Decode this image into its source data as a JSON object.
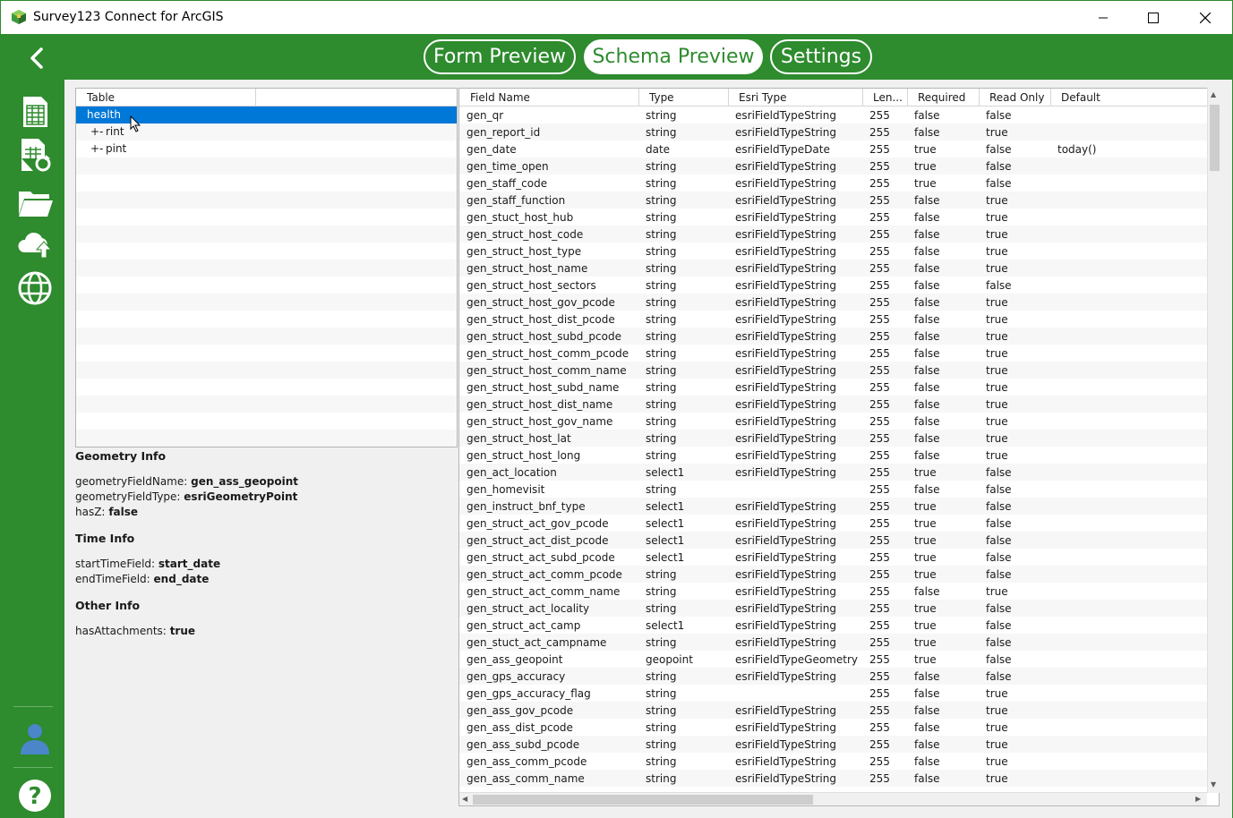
{
  "window": {
    "title": "Survey123 Connect for ArcGIS"
  },
  "tabs": [
    {
      "label": "Form Preview",
      "active": false
    },
    {
      "label": "Schema Preview",
      "active": true
    },
    {
      "label": "Settings",
      "active": false
    }
  ],
  "sidebar": {
    "items": [
      {
        "icon": "spreadsheet-icon"
      },
      {
        "icon": "spreadsheet-refresh-icon"
      },
      {
        "icon": "folder-icon"
      },
      {
        "icon": "cloud-upload-icon"
      },
      {
        "icon": "globe-icon"
      }
    ],
    "bottom": [
      {
        "icon": "user-icon"
      },
      {
        "icon": "help-icon"
      }
    ]
  },
  "tree": {
    "header": "Table",
    "rows": [
      {
        "label": "health",
        "indent": 0,
        "selected": true,
        "expander": ""
      },
      {
        "label": "rint",
        "indent": 1,
        "selected": false,
        "expander": "+-"
      },
      {
        "label": "pint",
        "indent": 1,
        "selected": false,
        "expander": "+-"
      }
    ]
  },
  "geometry_info": {
    "title": "Geometry Info",
    "rows": [
      {
        "key": "geometryFieldName:",
        "value": "gen_ass_geopoint"
      },
      {
        "key": "geometryFieldType:",
        "value": "esriGeometryPoint"
      },
      {
        "key": "hasZ:",
        "value": "false"
      }
    ]
  },
  "time_info": {
    "title": "Time Info",
    "rows": [
      {
        "key": "startTimeField:",
        "value": "start_date"
      },
      {
        "key": "endTimeField:",
        "value": "end_date"
      }
    ]
  },
  "other_info": {
    "title": "Other Info",
    "rows": [
      {
        "key": "hasAttachments:",
        "value": "true"
      }
    ]
  },
  "grid": {
    "headers": [
      "Field Name",
      "Type",
      "Esri Type",
      "Len...",
      "Required",
      "Read Only",
      "Default"
    ],
    "rows": [
      [
        "gen_qr",
        "string",
        "esriFieldTypeString",
        "255",
        "false",
        "false",
        ""
      ],
      [
        "gen_report_id",
        "string",
        "esriFieldTypeString",
        "255",
        "false",
        "true",
        ""
      ],
      [
        "gen_date",
        "date",
        "esriFieldTypeDate",
        "255",
        "true",
        "false",
        "today()"
      ],
      [
        "gen_time_open",
        "string",
        "esriFieldTypeString",
        "255",
        "true",
        "false",
        ""
      ],
      [
        "gen_staff_code",
        "string",
        "esriFieldTypeString",
        "255",
        "true",
        "false",
        ""
      ],
      [
        "gen_staff_function",
        "string",
        "esriFieldTypeString",
        "255",
        "false",
        "true",
        ""
      ],
      [
        "gen_stuct_host_hub",
        "string",
        "esriFieldTypeString",
        "255",
        "false",
        "true",
        ""
      ],
      [
        "gen_struct_host_code",
        "string",
        "esriFieldTypeString",
        "255",
        "false",
        "true",
        ""
      ],
      [
        "gen_struct_host_type",
        "string",
        "esriFieldTypeString",
        "255",
        "false",
        "true",
        ""
      ],
      [
        "gen_struct_host_name",
        "string",
        "esriFieldTypeString",
        "255",
        "false",
        "true",
        ""
      ],
      [
        "gen_struct_host_sectors",
        "string",
        "esriFieldTypeString",
        "255",
        "false",
        "false",
        ""
      ],
      [
        "gen_struct_host_gov_pcode",
        "string",
        "esriFieldTypeString",
        "255",
        "false",
        "true",
        ""
      ],
      [
        "gen_struct_host_dist_pcode",
        "string",
        "esriFieldTypeString",
        "255",
        "false",
        "true",
        ""
      ],
      [
        "gen_struct_host_subd_pcode",
        "string",
        "esriFieldTypeString",
        "255",
        "false",
        "true",
        ""
      ],
      [
        "gen_struct_host_comm_pcode",
        "string",
        "esriFieldTypeString",
        "255",
        "false",
        "true",
        ""
      ],
      [
        "gen_struct_host_comm_name",
        "string",
        "esriFieldTypeString",
        "255",
        "false",
        "true",
        ""
      ],
      [
        "gen_struct_host_subd_name",
        "string",
        "esriFieldTypeString",
        "255",
        "false",
        "true",
        ""
      ],
      [
        "gen_struct_host_dist_name",
        "string",
        "esriFieldTypeString",
        "255",
        "false",
        "true",
        ""
      ],
      [
        "gen_struct_host_gov_name",
        "string",
        "esriFieldTypeString",
        "255",
        "false",
        "true",
        ""
      ],
      [
        "gen_struct_host_lat",
        "string",
        "esriFieldTypeString",
        "255",
        "false",
        "true",
        ""
      ],
      [
        "gen_struct_host_long",
        "string",
        "esriFieldTypeString",
        "255",
        "false",
        "true",
        ""
      ],
      [
        "gen_act_location",
        "select1",
        "esriFieldTypeString",
        "255",
        "true",
        "false",
        ""
      ],
      [
        "gen_homevisit",
        "string",
        "",
        "255",
        "false",
        "false",
        ""
      ],
      [
        "gen_instruct_bnf_type",
        "select1",
        "esriFieldTypeString",
        "255",
        "true",
        "false",
        ""
      ],
      [
        "gen_struct_act_gov_pcode",
        "select1",
        "esriFieldTypeString",
        "255",
        "true",
        "false",
        ""
      ],
      [
        "gen_struct_act_dist_pcode",
        "select1",
        "esriFieldTypeString",
        "255",
        "true",
        "false",
        ""
      ],
      [
        "gen_struct_act_subd_pcode",
        "select1",
        "esriFieldTypeString",
        "255",
        "true",
        "false",
        ""
      ],
      [
        "gen_struct_act_comm_pcode",
        "string",
        "esriFieldTypeString",
        "255",
        "true",
        "false",
        ""
      ],
      [
        "gen_struct_act_comm_name",
        "string",
        "esriFieldTypeString",
        "255",
        "false",
        "true",
        ""
      ],
      [
        "gen_struct_act_locality",
        "string",
        "esriFieldTypeString",
        "255",
        "true",
        "false",
        ""
      ],
      [
        "gen_struct_act_camp",
        "select1",
        "esriFieldTypeString",
        "255",
        "true",
        "false",
        ""
      ],
      [
        "gen_stuct_act_campname",
        "string",
        "esriFieldTypeString",
        "255",
        "true",
        "false",
        ""
      ],
      [
        "gen_ass_geopoint",
        "geopoint",
        "esriFieldTypeGeometry",
        "255",
        "true",
        "false",
        ""
      ],
      [
        "gen_gps_accuracy",
        "string",
        "esriFieldTypeString",
        "255",
        "false",
        "false",
        ""
      ],
      [
        "gen_gps_accuracy_flag",
        "string",
        "",
        "255",
        "false",
        "true",
        ""
      ],
      [
        "gen_ass_gov_pcode",
        "string",
        "esriFieldTypeString",
        "255",
        "false",
        "true",
        ""
      ],
      [
        "gen_ass_dist_pcode",
        "string",
        "esriFieldTypeString",
        "255",
        "false",
        "true",
        ""
      ],
      [
        "gen_ass_subd_pcode",
        "string",
        "esriFieldTypeString",
        "255",
        "false",
        "true",
        ""
      ],
      [
        "gen_ass_comm_pcode",
        "string",
        "esriFieldTypeString",
        "255",
        "false",
        "true",
        ""
      ],
      [
        "gen_ass_comm_name",
        "string",
        "esriFieldTypeString",
        "255",
        "false",
        "true",
        ""
      ]
    ]
  },
  "colors": {
    "brand_green": "#2e8b2e",
    "selection_blue": "#0078d7"
  }
}
